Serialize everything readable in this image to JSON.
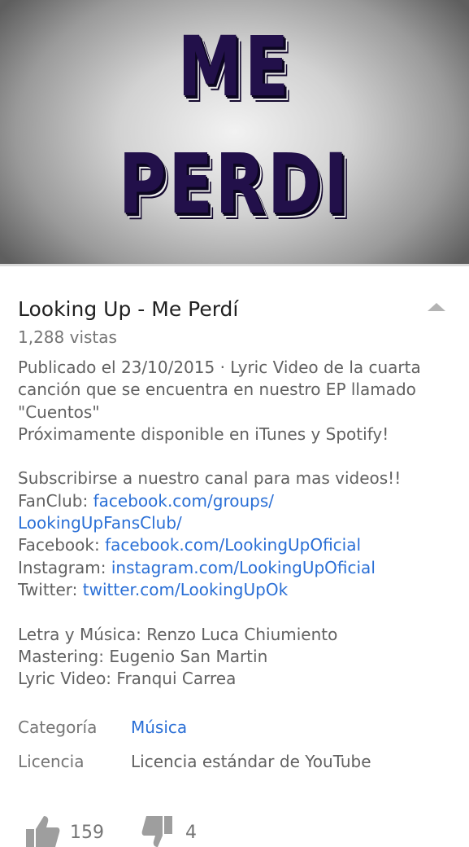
{
  "video": {
    "thumbnail_line1": "ME",
    "thumbnail_line2": "PERDI",
    "text_color": "#22104a"
  },
  "title": "Looking Up - Me Perdí",
  "views": "1,288 vistas",
  "description": {
    "lines": [
      {
        "text": "Publicado el 23/10/2015 · Lyric Video de la cuarta"
      },
      {
        "text": "canción que se encuentra en nuestro EP llamado"
      },
      {
        "text": "\"Cuentos\""
      },
      {
        "text": "Próximamente disponible en iTunes y Spotify!"
      },
      {
        "text": ""
      },
      {
        "text": "Subscribirse a nuestro canal para mas videos!!"
      },
      {
        "prefix": "FanClub: ",
        "link": "facebook.com/groups/"
      },
      {
        "link": "LookingUpFansClub/"
      },
      {
        "prefix": "Facebook: ",
        "link": "facebook.com/LookingUpOficial"
      },
      {
        "prefix": "Instagram: ",
        "link": "instagram.com/LookingUpOficial"
      },
      {
        "prefix": "Twitter: ",
        "link": "twitter.com/LookingUpOk"
      },
      {
        "text": ""
      },
      {
        "text": "Letra y Música: Renzo Luca Chiumiento"
      },
      {
        "text": "Mastering: Eugenio San Martin"
      },
      {
        "text": "Lyric Video: Franqui Carrea"
      }
    ]
  },
  "meta": {
    "category_label": "Categoría",
    "category_value": "Música",
    "license_label": "Licencia",
    "license_value": "Licencia estándar de YouTube"
  },
  "actions": {
    "likes": "159",
    "dislikes": "4"
  },
  "colors": {
    "link": "#2a6fd6",
    "text": "#616161",
    "title": "#212121"
  }
}
